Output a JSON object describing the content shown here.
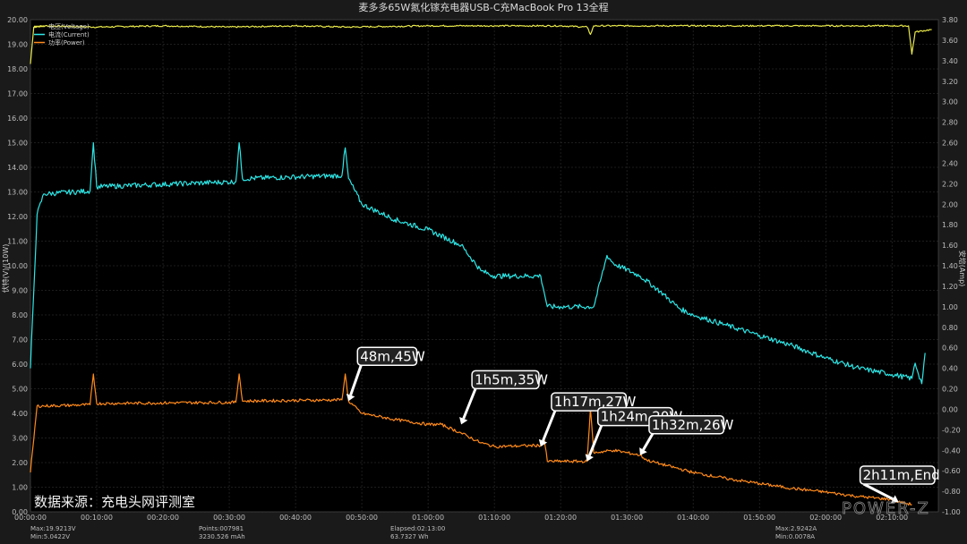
{
  "chart_data": {
    "type": "line",
    "title": "麦多多65W氮化镓充电器USB-C充MacBook Pro 13全程",
    "y1label": "伏特(V)/(10W)",
    "y2label": "安培(Amp)",
    "y1lim": [
      0,
      20
    ],
    "y2lim": [
      -1.0,
      3.8
    ],
    "y1ticks": [
      "0.00",
      "1.00",
      "2.00",
      "3.00",
      "4.00",
      "5.00",
      "6.00",
      "7.00",
      "8.00",
      "9.00",
      "10.00",
      "11.00",
      "12.00",
      "13.00",
      "14.00",
      "15.00",
      "16.00",
      "17.00",
      "18.00",
      "19.00",
      "20.00"
    ],
    "y2ticks": [
      "-1.00",
      "-0.80",
      "-0.60",
      "-0.40",
      "-0.20",
      "0.00",
      "0.20",
      "0.40",
      "0.60",
      "0.80",
      "1.00",
      "1.20",
      "1.40",
      "1.60",
      "1.80",
      "2.00",
      "2.20",
      "2.40",
      "2.60",
      "2.80",
      "3.00",
      "3.20",
      "3.40",
      "3.60",
      "3.80"
    ],
    "xticks": [
      "00:00:00",
      "00:10:00",
      "00:20:00",
      "00:30:00",
      "00:40:00",
      "00:50:00",
      "01:00:00",
      "01:10:00",
      "01:20:00",
      "01:30:00",
      "01:40:00",
      "01:50:00",
      "02:00:00",
      "02:10:00"
    ],
    "xlim_minutes": [
      0,
      137
    ],
    "legend": [
      "电压(Voltage)",
      "电流(Current)",
      "功率(Power)"
    ],
    "legend_position": "top-left",
    "grid": true,
    "series": [
      {
        "name": "电压(Voltage)",
        "color": "#e8e84a",
        "axis": "left",
        "unit": "V",
        "x": [
          0,
          0.5,
          2,
          10,
          20,
          30,
          40,
          48,
          60,
          70,
          80,
          84,
          84.5,
          85,
          90,
          100,
          110,
          120,
          130,
          132.5,
          133,
          133.5,
          136
        ],
        "y": [
          18.2,
          19.7,
          19.75,
          19.7,
          19.75,
          19.7,
          19.75,
          19.7,
          19.75,
          19.75,
          19.75,
          19.7,
          19.4,
          19.75,
          19.75,
          19.75,
          19.75,
          19.75,
          19.75,
          19.75,
          18.6,
          19.5,
          19.6
        ]
      },
      {
        "name": "电流(Current)",
        "color": "#2ee6e6",
        "axis": "right",
        "unit": "A",
        "x": [
          0,
          1,
          2,
          9,
          9.5,
          10,
          31,
          31.5,
          32,
          47,
          47.5,
          48,
          50,
          55,
          60,
          65,
          68,
          70,
          72,
          77,
          78,
          80,
          82,
          85,
          87,
          88,
          92,
          95,
          98,
          100,
          105,
          110,
          115,
          120,
          125,
          130,
          133,
          133.5,
          134.5,
          135
        ],
        "y": [
          0.4,
          1.9,
          2.1,
          2.13,
          2.6,
          2.17,
          2.22,
          2.6,
          2.25,
          2.28,
          2.55,
          2.25,
          2.0,
          1.85,
          1.75,
          1.6,
          1.35,
          1.3,
          1.3,
          1.3,
          1.0,
          1.0,
          1.0,
          1.0,
          1.5,
          1.42,
          1.3,
          1.15,
          0.98,
          0.92,
          0.82,
          0.72,
          0.62,
          0.5,
          0.4,
          0.34,
          0.3,
          0.45,
          0.25,
          0.55
        ]
      },
      {
        "name": "功率(Power)",
        "color": "#ff8a1c",
        "axis": "left",
        "unit": "10W",
        "x": [
          0,
          1,
          2,
          9,
          9.5,
          10,
          31,
          31.5,
          32,
          47,
          47.5,
          48,
          50,
          55,
          60,
          62,
          65,
          68,
          70,
          77,
          77.5,
          78,
          84,
          84.5,
          85,
          88,
          92,
          93,
          95,
          100,
          105,
          110,
          115,
          120,
          125,
          130,
          131,
          133
        ],
        "y": [
          1.6,
          4.3,
          4.3,
          4.35,
          5.6,
          4.4,
          4.45,
          5.6,
          4.5,
          4.55,
          5.6,
          4.5,
          4.0,
          3.75,
          3.55,
          3.55,
          3.2,
          2.8,
          2.65,
          2.7,
          3.0,
          2.05,
          2.05,
          4.2,
          2.4,
          2.5,
          2.3,
          2.1,
          1.95,
          1.6,
          1.35,
          1.15,
          0.95,
          0.8,
          0.62,
          0.5,
          0.4,
          0.3
        ]
      }
    ],
    "annotations": [
      {
        "text": "48m,45W",
        "arrow_to_minute": 48,
        "arrow_to_value": 4.5
      },
      {
        "text": "1h5m,35W",
        "arrow_to_minute": 65,
        "arrow_to_value": 3.55
      },
      {
        "text": "1h17m,27W",
        "arrow_to_minute": 77,
        "arrow_to_value": 2.65
      },
      {
        "text": "1h24m,20W",
        "arrow_to_minute": 84,
        "arrow_to_value": 2.05
      },
      {
        "text": "1h32m,26W",
        "arrow_to_minute": 92,
        "arrow_to_value": 2.3
      },
      {
        "text": "2h11m,End",
        "arrow_to_minute": 131,
        "arrow_to_value": 0.4
      }
    ],
    "stats": {
      "voltage_max": "Max:19.9213V",
      "voltage_min": "Min:5.0422V",
      "points": "Points:007981",
      "capacity": "3230.526 mAh",
      "elapsed": "Elapsed:02:13:00",
      "energy": "63.7327 Wh",
      "current_max": "Max:2.9242A",
      "current_min": "Min:0.0078A"
    }
  },
  "watermark": "数据来源：充电头网评测室",
  "brand_logo": "POWER-Z"
}
